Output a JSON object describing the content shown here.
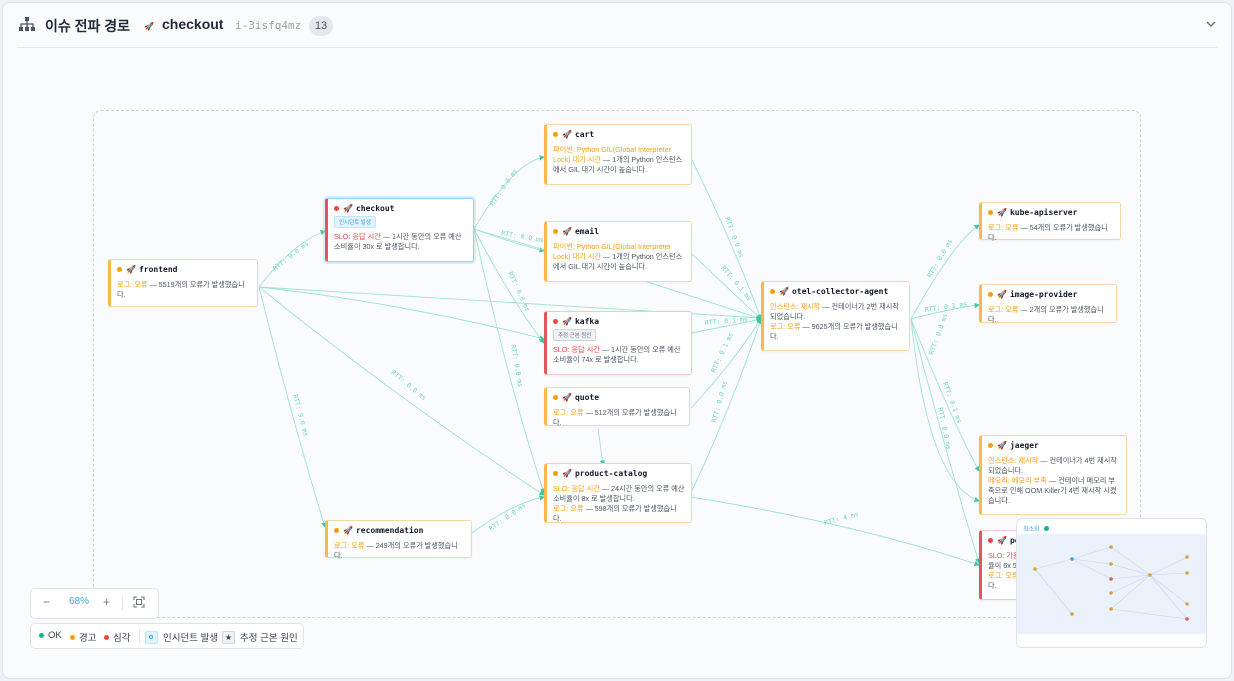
{
  "header": {
    "title": "이슈 전파 경로",
    "service": "checkout",
    "issue_id": "i-3isfq4mz",
    "count": "13"
  },
  "nodes": {
    "frontend": {
      "name": "frontend",
      "status": "warn",
      "label1": "로그: 오류",
      "text1": " — 5519개의 오류가 발생했습니다."
    },
    "checkout": {
      "name": "checkout",
      "status": "critical",
      "badge": "인시던트 발생",
      "label1": "SLO: 응답 시간",
      "text1": " — 1시간 동안의 오류 예산 소비율이 30x 로 발생합니다."
    },
    "recommendation": {
      "name": "recommendation",
      "status": "warn",
      "label1": "로그: 오류",
      "text1": " — 249개의 오류가 발생했습니다."
    },
    "cart": {
      "name": "cart",
      "status": "warn",
      "label1": "파이썬: Python GIL(Global Interpreter Lock) 대기 시간",
      "text1": " — 1개의 Python 인스턴스에서 GIL 대기 시간이 높습니다."
    },
    "email": {
      "name": "email",
      "status": "warn",
      "label1": "파이썬: Python GIL(Global Interpreter Lock) 대기 시간",
      "text1": " — 1개의 Python 인스턴스에서 GIL 대기 시간이 높습니다."
    },
    "kafka": {
      "name": "kafka",
      "status": "critical",
      "badge": "추정 근본 원인",
      "label1": "SLO: 응답 시간",
      "text1": " — 1시간 동안의 오류 예산 소비율이 74x 로 발생합니다."
    },
    "quote": {
      "name": "quote",
      "status": "warn",
      "label1": "로그: 오류",
      "text1": " — 512개의 오류가 발생했습니다."
    },
    "product_catalog": {
      "name": "product-catalog",
      "status": "warn",
      "label1": "SLO: 응답 시간",
      "text1": " — 24시간 동안의 오류 예산 소비율이 8x 로 발생합니다.",
      "label2": "로그: 오류",
      "text2": " — 598개의 오류가 발생했습니다."
    },
    "otel": {
      "name": "otel-collector-agent",
      "status": "warn",
      "label1": "인스턴스: 재시작",
      "text1": " — 컨테이너가 2번 재시작되었습니다.",
      "label2": "로그: 오류",
      "text2": " — 9625개의 오류가 발생했습니다."
    },
    "kube": {
      "name": "kube-apiserver",
      "status": "warn",
      "label1": "로그: 오류",
      "text1": " — 54개의 오류가 발생했습니다."
    },
    "image": {
      "name": "image-provider",
      "status": "warn",
      "label1": "로그: 오류",
      "text1": " — 2개의 오류가 발생했습니다."
    },
    "jaeger": {
      "name": "jaeger",
      "status": "warn",
      "label1": "인스턴스: 재시작",
      "text1": " — 컨테이너가 4번 재시작되었습니다.",
      "label2": "메모리: 메모리 부족",
      "text2": " — 컨테이너 메모리 부족으로 인해 OOM Killer가 4번 재시작 시켰습니다."
    },
    "postgres": {
      "name": "po",
      "status": "critical",
      "label1": "SLO: 가용",
      "text1": "율이 6x 5",
      "label2": "로그: 오류",
      "text2": "다."
    }
  },
  "edges": {
    "rtt_00": "RTT: 0.0 ms",
    "rtt_01": "RTT: 0.1 ms",
    "rtt_02": "RTT: 0.2 ms",
    "rtt_50": "RTT: 5.0 ms",
    "rtt_40": "RTT: 4 ms",
    "rtt_90": "RTT: 9.0 ms",
    "rtt_80": "RTT: 8.0 ms"
  },
  "controls": {
    "zoom_minus": "−",
    "zoom_value": "68%",
    "zoom_plus": "+"
  },
  "legend": {
    "ok": "OK",
    "warn": "경고",
    "crit": "심각",
    "incident": "인시던트 발생",
    "root": "추정 근본 원인"
  },
  "minimap": {
    "label": "최소화"
  },
  "colors": {
    "accent": "#38bdf8",
    "warn": "#f59e0b",
    "critical": "#ef4444",
    "ok": "#10b981",
    "edge": "#8fe0cd"
  }
}
